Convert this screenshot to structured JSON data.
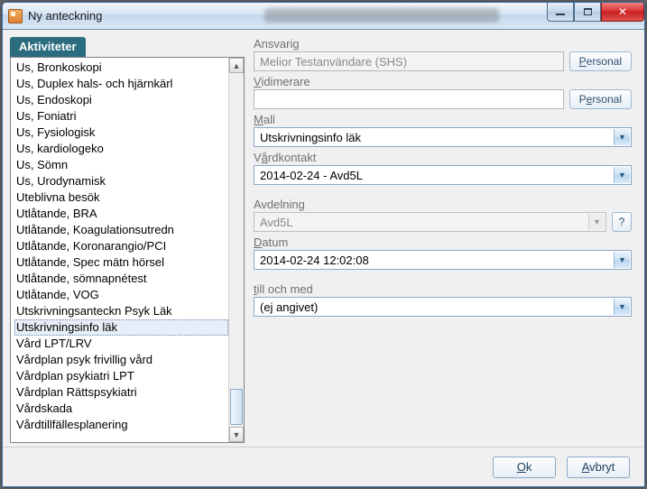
{
  "window": {
    "title": "Ny anteckning",
    "min_tooltip": "Minimera",
    "max_tooltip": "Maximera",
    "close_tooltip": "Stäng"
  },
  "sidebar": {
    "tab_label": "Aktiviteter",
    "selected_index": 14,
    "items": [
      "Us, Bronkoskopi",
      "Us, Duplex hals- och hjärnkärl",
      "Us, Endoskopi",
      "Us, Foniatri",
      "Us, Fysiologisk",
      "Us, kardiologeko",
      "Us, Sömn",
      "Us, Urodynamisk",
      "Uteblivna besök",
      "Utlåtande, BRA",
      "Utlåtande, Koagulationsutredn",
      "Utlåtande, Koronarangio/PCI",
      "Utlåtande, Spec mätn hörsel",
      "Utlåtande, sömnapnétest",
      "Utlåtande, VOG",
      "Utskrivningsanteckn Psyk Läk",
      "Utskrivningsinfo läk",
      "Vård LPT/LRV",
      "Vårdplan psyk frivillig vård",
      "Vårdplan psykiatri LPT",
      "Vårdplan Rättspsykiatri",
      "Vårdskada",
      "Vårdtillfällesplanering"
    ]
  },
  "form": {
    "ansvarig": {
      "label": "Ansvarig",
      "value": "Melior Testanvändare (SHS)",
      "button": "Personal"
    },
    "vidimerare": {
      "label": "Vidimerare",
      "value": "",
      "button": "Personal"
    },
    "mall": {
      "label": "Mall",
      "value": "Utskrivningsinfo läk"
    },
    "vardkontakt": {
      "label": "Vårdkontakt",
      "value": "2014-02-24 -  Avd5L"
    },
    "avdelning": {
      "label": "Avdelning",
      "value": "Avd5L",
      "help": "?"
    },
    "datum": {
      "label": "Datum",
      "value": "2014-02-24 12:02:08"
    },
    "tom": {
      "label": "till och med",
      "value": "(ej angivet)"
    }
  },
  "footer": {
    "ok": "Ok",
    "cancel": "Avbryt"
  }
}
